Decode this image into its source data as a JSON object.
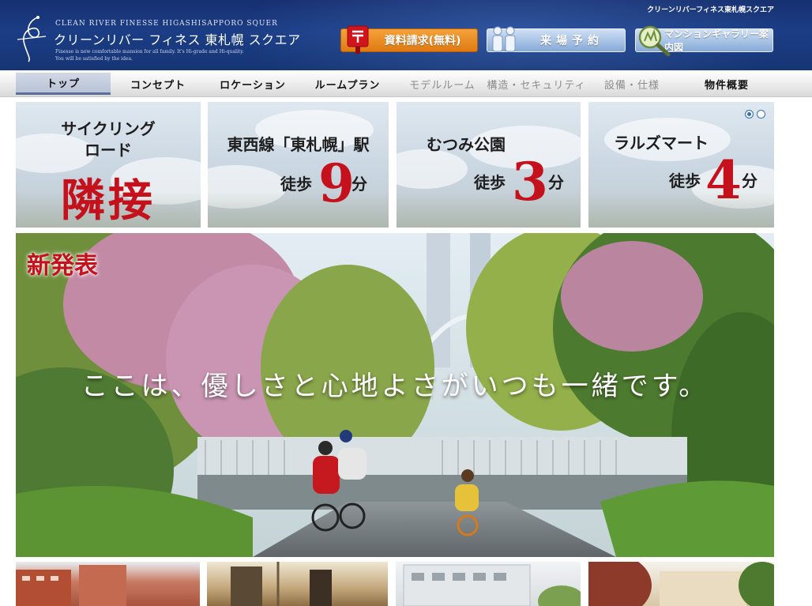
{
  "header": {
    "logo_en": "CLEAN RIVER FINESSE HIGASHISAPPORO SQUER",
    "logo_jp": "クリーンリバー フィネス 東札幌 スクエア",
    "tagline_1": "Finesse is new comfortable mansion for all family. It's Hi-grade and Hi-quality.",
    "tagline_2": "You will be satisfied by the idea.",
    "site_name": "クリーンリバーフィネス東札幌スクエア",
    "buttons": {
      "document_request": "資料請求(無料)",
      "visit_reservation": "来場予約",
      "gallery_guide": "マンションギャラリー案内図"
    }
  },
  "nav": {
    "items": [
      {
        "label": "トップ",
        "state": "active"
      },
      {
        "label": "コンセプト",
        "state": "normal"
      },
      {
        "label": "ロケーション",
        "state": "normal"
      },
      {
        "label": "ルームプラン",
        "state": "normal"
      },
      {
        "label": "モデルルーム",
        "state": "disabled"
      },
      {
        "label": "構造・セキュリティ",
        "state": "disabled"
      },
      {
        "label": "設備・仕様",
        "state": "disabled"
      },
      {
        "label": "物件概要",
        "state": "normal"
      }
    ]
  },
  "features": [
    {
      "line1": "サイクリング",
      "line2": "ロード",
      "highlight": "隣接"
    },
    {
      "line1": "東西線「東札幌」駅",
      "walk": "徒歩",
      "number": "9",
      "unit": "分"
    },
    {
      "line1": "むつみ公園",
      "walk": "徒歩",
      "number": "3",
      "unit": "分"
    },
    {
      "line1": "ラルズマート",
      "walk": "徒歩",
      "number": "4",
      "unit": "分"
    }
  ],
  "slider": {
    "total": 2,
    "current": 1
  },
  "hero": {
    "badge": "新発表",
    "headline": "ここは、優しさと心地よさがいつも一緒です。"
  },
  "colors": {
    "header_blue": "#1b3d85",
    "accent_red": "#c4111b",
    "button_orange": "#e88a1f",
    "button_light_blue": "#a9c4e6"
  }
}
